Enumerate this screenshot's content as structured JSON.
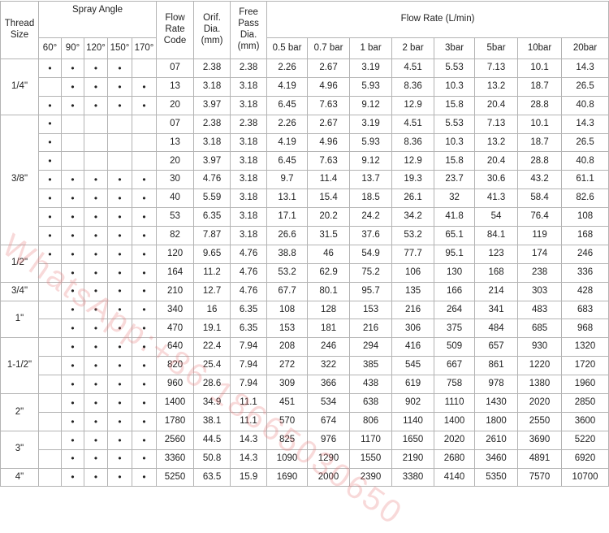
{
  "headers": {
    "thread_size": [
      "Thread",
      "Size"
    ],
    "spray_angle": "Spray Angle",
    "flow_rate_code": [
      "Flow",
      "Rate",
      "Code"
    ],
    "orif_dia": [
      "Orif.",
      "Dia.",
      "(mm)"
    ],
    "free_pass_dia": [
      "Free",
      "Pass",
      "Dia.",
      "(mm)"
    ],
    "flow_rate": "Flow Rate (L/min)",
    "angles": [
      "60°",
      "90°",
      "120°",
      "150°",
      "170°"
    ],
    "pressures": [
      "0.5 bar",
      "0.7 bar",
      "1 bar",
      "2 bar",
      "3bar",
      "5bar",
      "10bar",
      "20bar"
    ]
  },
  "dot": "•",
  "groups": [
    {
      "thread": "1/4\"",
      "rows": [
        {
          "angles": [
            1,
            1,
            1,
            1,
            0
          ],
          "code": "07",
          "orif": "2.38",
          "free": "2.38",
          "flow": [
            "2.26",
            "2.67",
            "3.19",
            "4.51",
            "5.53",
            "7.13",
            "10.1",
            "14.3"
          ]
        },
        {
          "angles": [
            0,
            1,
            1,
            1,
            1
          ],
          "code": "13",
          "orif": "3.18",
          "free": "3.18",
          "flow": [
            "4.19",
            "4.96",
            "5.93",
            "8.36",
            "10.3",
            "13.2",
            "18.7",
            "26.5"
          ]
        },
        {
          "angles": [
            1,
            1,
            1,
            1,
            1
          ],
          "code": "20",
          "orif": "3.97",
          "free": "3.18",
          "flow": [
            "6.45",
            "7.63",
            "9.12",
            "12.9",
            "15.8",
            "20.4",
            "28.8",
            "40.8"
          ]
        }
      ]
    },
    {
      "thread": "3/8\"",
      "rows": [
        {
          "angles": [
            1,
            0,
            0,
            0,
            0
          ],
          "code": "07",
          "orif": "2.38",
          "free": "2.38",
          "flow": [
            "2.26",
            "2.67",
            "3.19",
            "4.51",
            "5.53",
            "7.13",
            "10.1",
            "14.3"
          ]
        },
        {
          "angles": [
            1,
            0,
            0,
            0,
            0
          ],
          "code": "13",
          "orif": "3.18",
          "free": "3.18",
          "flow": [
            "4.19",
            "4.96",
            "5.93",
            "8.36",
            "10.3",
            "13.2",
            "18.7",
            "26.5"
          ]
        },
        {
          "angles": [
            1,
            0,
            0,
            0,
            0
          ],
          "code": "20",
          "orif": "3.97",
          "free": "3.18",
          "flow": [
            "6.45",
            "7.63",
            "9.12",
            "12.9",
            "15.8",
            "20.4",
            "28.8",
            "40.8"
          ]
        },
        {
          "angles": [
            1,
            1,
            1,
            1,
            1
          ],
          "code": "30",
          "orif": "4.76",
          "free": "3.18",
          "flow": [
            "9.7",
            "11.4",
            "13.7",
            "19.3",
            "23.7",
            "30.6",
            "43.2",
            "61.1"
          ]
        },
        {
          "angles": [
            1,
            1,
            1,
            1,
            1
          ],
          "code": "40",
          "orif": "5.59",
          "free": "3.18",
          "flow": [
            "13.1",
            "15.4",
            "18.5",
            "26.1",
            "32",
            "41.3",
            "58.4",
            "82.6"
          ]
        },
        {
          "angles": [
            1,
            1,
            1,
            1,
            1
          ],
          "code": "53",
          "orif": "6.35",
          "free": "3.18",
          "flow": [
            "17.1",
            "20.2",
            "24.2",
            "34.2",
            "41.8",
            "54",
            "76.4",
            "108"
          ]
        },
        {
          "angles": [
            1,
            1,
            1,
            1,
            1
          ],
          "code": "82",
          "orif": "7.87",
          "free": "3.18",
          "flow": [
            "26.6",
            "31.5",
            "37.6",
            "53.2",
            "65.1",
            "84.1",
            "119",
            "168"
          ]
        }
      ]
    },
    {
      "thread": "1/2\"",
      "rows": [
        {
          "angles": [
            1,
            1,
            1,
            1,
            1
          ],
          "code": "120",
          "orif": "9.65",
          "free": "4.76",
          "flow": [
            "38.8",
            "46",
            "54.9",
            "77.7",
            "95.1",
            "123",
            "174",
            "246"
          ]
        },
        {
          "angles": [
            0,
            1,
            1,
            1,
            1
          ],
          "code": "164",
          "orif": "11.2",
          "free": "4.76",
          "flow": [
            "53.2",
            "62.9",
            "75.2",
            "106",
            "130",
            "168",
            "238",
            "336"
          ]
        }
      ]
    },
    {
      "thread": "3/4\"",
      "rows": [
        {
          "angles": [
            0,
            1,
            1,
            1,
            1
          ],
          "code": "210",
          "orif": "12.7",
          "free": "4.76",
          "flow": [
            "67.7",
            "80.1",
            "95.7",
            "135",
            "166",
            "214",
            "303",
            "428"
          ]
        }
      ]
    },
    {
      "thread": "1\"",
      "rows": [
        {
          "angles": [
            0,
            1,
            1,
            1,
            1
          ],
          "code": "340",
          "orif": "16",
          "free": "6.35",
          "flow": [
            "108",
            "128",
            "153",
            "216",
            "264",
            "341",
            "483",
            "683"
          ]
        },
        {
          "angles": [
            0,
            1,
            1,
            1,
            1
          ],
          "code": "470",
          "orif": "19.1",
          "free": "6.35",
          "flow": [
            "153",
            "181",
            "216",
            "306",
            "375",
            "484",
            "685",
            "968"
          ]
        }
      ]
    },
    {
      "thread": "1-1/2\"",
      "rows": [
        {
          "angles": [
            0,
            1,
            1,
            1,
            1
          ],
          "code": "640",
          "orif": "22.4",
          "free": "7.94",
          "flow": [
            "208",
            "246",
            "294",
            "416",
            "509",
            "657",
            "930",
            "1320"
          ]
        },
        {
          "angles": [
            0,
            1,
            1,
            1,
            1
          ],
          "code": "820",
          "orif": "25.4",
          "free": "7.94",
          "flow": [
            "272",
            "322",
            "385",
            "545",
            "667",
            "861",
            "1220",
            "1720"
          ]
        },
        {
          "angles": [
            0,
            1,
            1,
            1,
            1
          ],
          "code": "960",
          "orif": "28.6",
          "free": "7.94",
          "flow": [
            "309",
            "366",
            "438",
            "619",
            "758",
            "978",
            "1380",
            "1960"
          ]
        }
      ]
    },
    {
      "thread": "2\"",
      "rows": [
        {
          "angles": [
            0,
            1,
            1,
            1,
            1
          ],
          "code": "1400",
          "orif": "34.9",
          "free": "11.1",
          "flow": [
            "451",
            "534",
            "638",
            "902",
            "1110",
            "1430",
            "2020",
            "2850"
          ]
        },
        {
          "angles": [
            0,
            1,
            1,
            1,
            1
          ],
          "code": "1780",
          "orif": "38.1",
          "free": "11.1",
          "flow": [
            "570",
            "674",
            "806",
            "1140",
            "1400",
            "1800",
            "2550",
            "3600"
          ]
        }
      ]
    },
    {
      "thread": "3\"",
      "rows": [
        {
          "angles": [
            0,
            1,
            1,
            1,
            1
          ],
          "code": "2560",
          "orif": "44.5",
          "free": "14.3",
          "flow": [
            "825",
            "976",
            "1170",
            "1650",
            "2020",
            "2610",
            "3690",
            "5220"
          ]
        },
        {
          "angles": [
            0,
            1,
            1,
            1,
            1
          ],
          "code": "3360",
          "orif": "50.8",
          "free": "14.3",
          "flow": [
            "1090",
            "1290",
            "1550",
            "2190",
            "2680",
            "3460",
            "4891",
            "6920"
          ]
        }
      ]
    },
    {
      "thread": "4\"",
      "rows": [
        {
          "angles": [
            0,
            1,
            1,
            1,
            1
          ],
          "code": "5250",
          "orif": "63.5",
          "free": "15.9",
          "flow": [
            "1690",
            "2000",
            "2390",
            "3380",
            "4140",
            "5350",
            "7570",
            "10700"
          ]
        }
      ]
    }
  ],
  "watermark": "WhatsApp:+86 18665030650"
}
